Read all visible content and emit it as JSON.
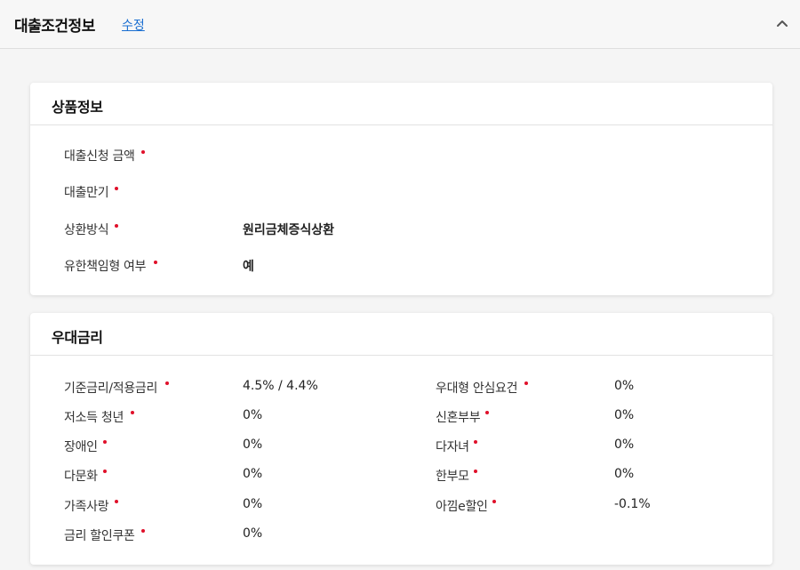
{
  "header": {
    "title": "대출조건정보",
    "edit_label": "수정",
    "collapse_icon": "chevron-up-icon"
  },
  "product": {
    "title": "상품정보",
    "rows": [
      {
        "label": "대출신청 금액",
        "value": ""
      },
      {
        "label": "대출만기",
        "value": ""
      },
      {
        "label": "상환방식",
        "value": "원리금체증식상환"
      },
      {
        "label": "유한책임형 여부",
        "value": "예"
      }
    ]
  },
  "rates": {
    "title": "우대금리",
    "left": [
      {
        "label": "기준금리/적용금리",
        "value": "4.5%  /  4.4%"
      },
      {
        "label": "저소득 청년",
        "value": "0%"
      },
      {
        "label": "장애인",
        "value": "0%"
      },
      {
        "label": "다문화",
        "value": "0%"
      },
      {
        "label": "가족사랑",
        "value": "0%"
      },
      {
        "label": "금리 할인쿠폰",
        "value": "0%"
      }
    ],
    "right": [
      {
        "label": "우대형 안심요건",
        "value": "0%"
      },
      {
        "label": "신혼부부",
        "value": "0%"
      },
      {
        "label": "다자녀",
        "value": "0%"
      },
      {
        "label": "한부모",
        "value": "0%"
      },
      {
        "label": "아낌e할인",
        "value": "-0.1%"
      }
    ]
  },
  "colors": {
    "required_dot": "#e0102a",
    "link": "#1a6fd1"
  }
}
